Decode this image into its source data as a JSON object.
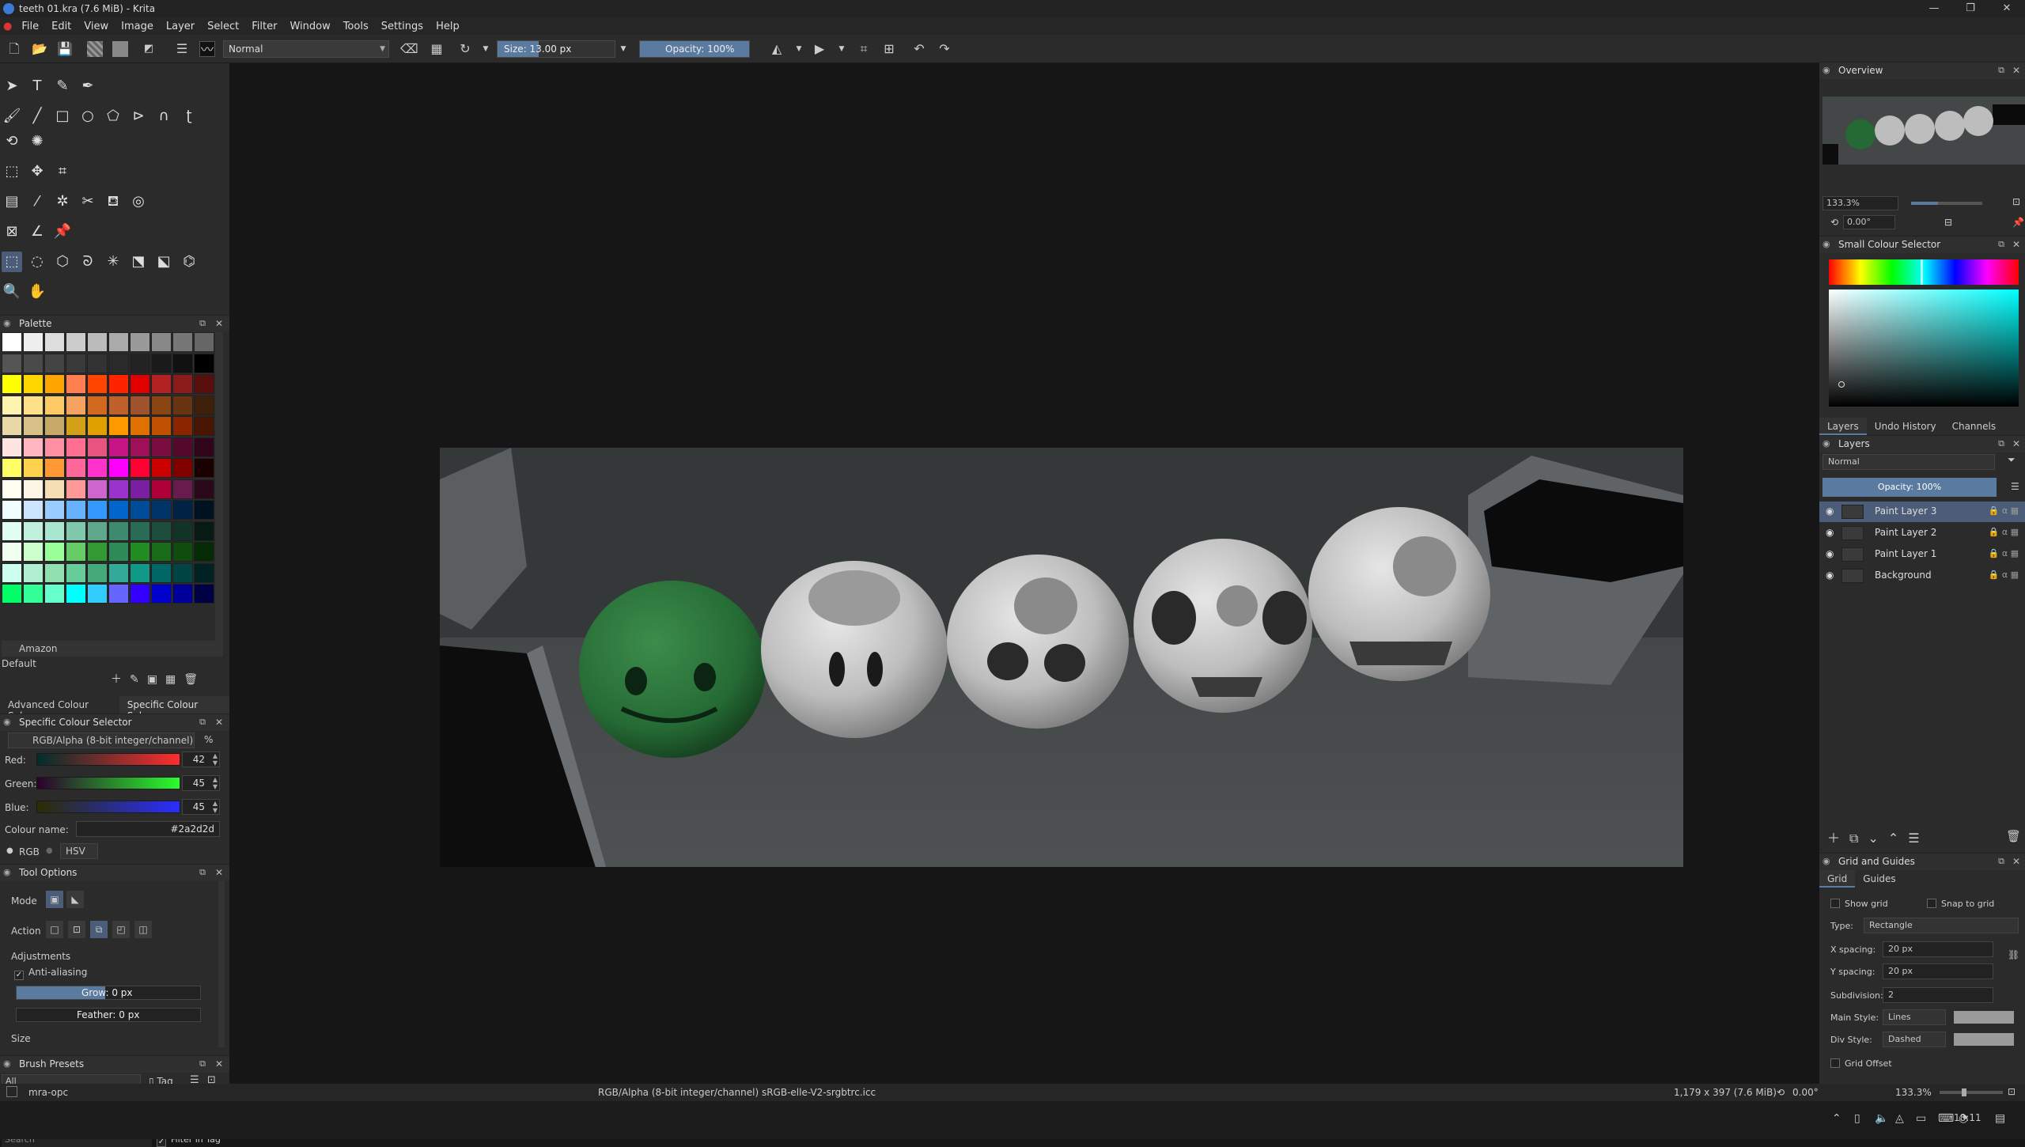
{
  "window": {
    "title": "teeth 01.kra (7.6 MiB) - Krita",
    "controls": [
      "—",
      "❐",
      "✕"
    ]
  },
  "menu": [
    "File",
    "Edit",
    "View",
    "Image",
    "Layer",
    "Select",
    "Filter",
    "Window",
    "Tools",
    "Settings",
    "Help"
  ],
  "toolbar": {
    "blend_mode": "Normal",
    "size": "Size: 13.00 px",
    "size_fraction": 0.35,
    "opacity": "Opacity: 100%",
    "opacity_fraction": 1.0
  },
  "palette": {
    "title": "Palette",
    "name": "Amazon",
    "set": "Default",
    "colors": [
      [
        "#ffffff",
        "#eeeeee",
        "#dddddd",
        "#cccccc",
        "#bbbbbb",
        "#aaaaaa",
        "#999999",
        "#888888",
        "#777777",
        "#666666"
      ],
      [
        "#555555",
        "#4a4a4a",
        "#444444",
        "#3a3a3a",
        "#333333",
        "#2a2a2a",
        "#222222",
        "#1a1a1a",
        "#111111",
        "#000000"
      ],
      [
        "#ffff00",
        "#ffd700",
        "#ffa500",
        "#ff7f50",
        "#ff4500",
        "#ff2400",
        "#e00000",
        "#b22222",
        "#8b1a1a",
        "#5a0f0f"
      ],
      [
        "#fff3b0",
        "#ffe08a",
        "#ffc966",
        "#f4a460",
        "#d2691e",
        "#c0602a",
        "#a0522d",
        "#8b4513",
        "#6b3410",
        "#3e1f0a"
      ],
      [
        "#e8d8a8",
        "#d8c088",
        "#c8a868",
        "#d4a017",
        "#e0a000",
        "#ff9900",
        "#e07000",
        "#c05000",
        "#8b2500",
        "#4a1500"
      ],
      [
        "#ffe4e1",
        "#ffb6c1",
        "#ff8fa3",
        "#ff6f91",
        "#e75480",
        "#c71585",
        "#a0105a",
        "#7a0c40",
        "#55082c",
        "#30041a"
      ],
      [
        "#ffff66",
        "#ffd24d",
        "#ff9933",
        "#ff6699",
        "#ff33cc",
        "#ff00ff",
        "#ff0033",
        "#cc0000",
        "#800000",
        "#1a0000"
      ],
      [
        "#fffff0",
        "#fdf5e6",
        "#f5deb3",
        "#ff9999",
        "#cc66cc",
        "#9933cc",
        "#7b1fa2",
        "#b0003a",
        "#6a1b4d",
        "#2a0a1a"
      ],
      [
        "#f0ffff",
        "#cce5ff",
        "#99ccff",
        "#66b2ff",
        "#3399ff",
        "#0066cc",
        "#004c99",
        "#003366",
        "#002244",
        "#001122"
      ],
      [
        "#e0fff0",
        "#c1f0dc",
        "#a8e6cf",
        "#7fc8a9",
        "#5fa88c",
        "#3d8b6f",
        "#2a6b55",
        "#1d4d3d",
        "#123328",
        "#081a14"
      ],
      [
        "#f0fff0",
        "#ccffcc",
        "#99ff99",
        "#66cc66",
        "#339933",
        "#2e8b57",
        "#228b22",
        "#1a6b1a",
        "#0f4d0f",
        "#062906"
      ],
      [
        "#ccffee",
        "#b0f0d0",
        "#90e0b0",
        "#66cc99",
        "#44aa77",
        "#33aa99",
        "#119988",
        "#006666",
        "#004444",
        "#002222"
      ],
      [
        "#00ff66",
        "#33ff99",
        "#66ffcc",
        "#00ffff",
        "#33ccff",
        "#6666ff",
        "#3300ff",
        "#0000cc",
        "#000099",
        "#000044"
      ]
    ]
  },
  "colour_tabs": [
    "Advanced Colour Sele...",
    "Specific Colour Sele..."
  ],
  "specific_colour": {
    "title": "Specific Colour Selector",
    "profile": "RGB/Alpha (8-bit integer/channel)",
    "red_label": "Red:",
    "red": "42",
    "green_label": "Green:",
    "green": "45",
    "blue_label": "Blue:",
    "blue": "45",
    "name_label": "Colour name:",
    "hex": "#2a2d2d",
    "rgb_label": "RGB",
    "hsv_label": "HSV"
  },
  "tool_options": {
    "title": "Tool Options",
    "mode_label": "Mode",
    "action_label": "Action",
    "adjustments_label": "Adjustments",
    "anti_aliasing": "Anti-aliasing",
    "grow": "Grow: 0 px",
    "feather": "Feather: 0 px",
    "size_label": "Size"
  },
  "brush_presets": {
    "title": "Brush Presets",
    "filter": "All",
    "tag": "Tag",
    "search_placeholder": "Search",
    "filter_in_tag": "Filter in Tag"
  },
  "overview": {
    "title": "Overview",
    "zoom": "133.3%",
    "rotation": "0.00°"
  },
  "small_colour": {
    "title": "Small Colour Selector"
  },
  "right_tabs": [
    "Layers",
    "Undo History",
    "Channels"
  ],
  "layers": {
    "title": "Layers",
    "blend": "Normal",
    "opacity": "Opacity:  100%",
    "items": [
      {
        "name": "Paint Layer 3",
        "selected": true
      },
      {
        "name": "Paint Layer 2",
        "selected": false
      },
      {
        "name": "Paint Layer 1",
        "selected": false
      },
      {
        "name": "Background",
        "selected": false
      }
    ]
  },
  "grid": {
    "title": "Grid and Guides",
    "tabs": [
      "Grid",
      "Guides"
    ],
    "show_grid": "Show grid",
    "snap": "Snap to grid",
    "type_label": "Type:",
    "type": "Rectangle",
    "xs_label": "X spacing:",
    "xs": "20 px",
    "ys_label": "Y spacing:",
    "ys": "20 px",
    "sub_label": "Subdivision:",
    "sub": "2",
    "main_label": "Main Style:",
    "main": "Lines",
    "div_label": "Div Style:",
    "div": "Dashed",
    "offset": "Grid Offset"
  },
  "status": {
    "brush": "mra-opc",
    "colorspace": "RGB/Alpha (8-bit integer/channel)  sRGB-elle-V2-srgbtrc.icc",
    "dims": "1,179 x 397 (7.6 MiB)",
    "rotation": "0.00°",
    "zoom": "133.3%"
  },
  "taskbar": {
    "time": "18:11"
  },
  "colors": {
    "accent": "#4b5d78",
    "panel": "#2b2b2b",
    "canvas_bg": "#161616"
  }
}
